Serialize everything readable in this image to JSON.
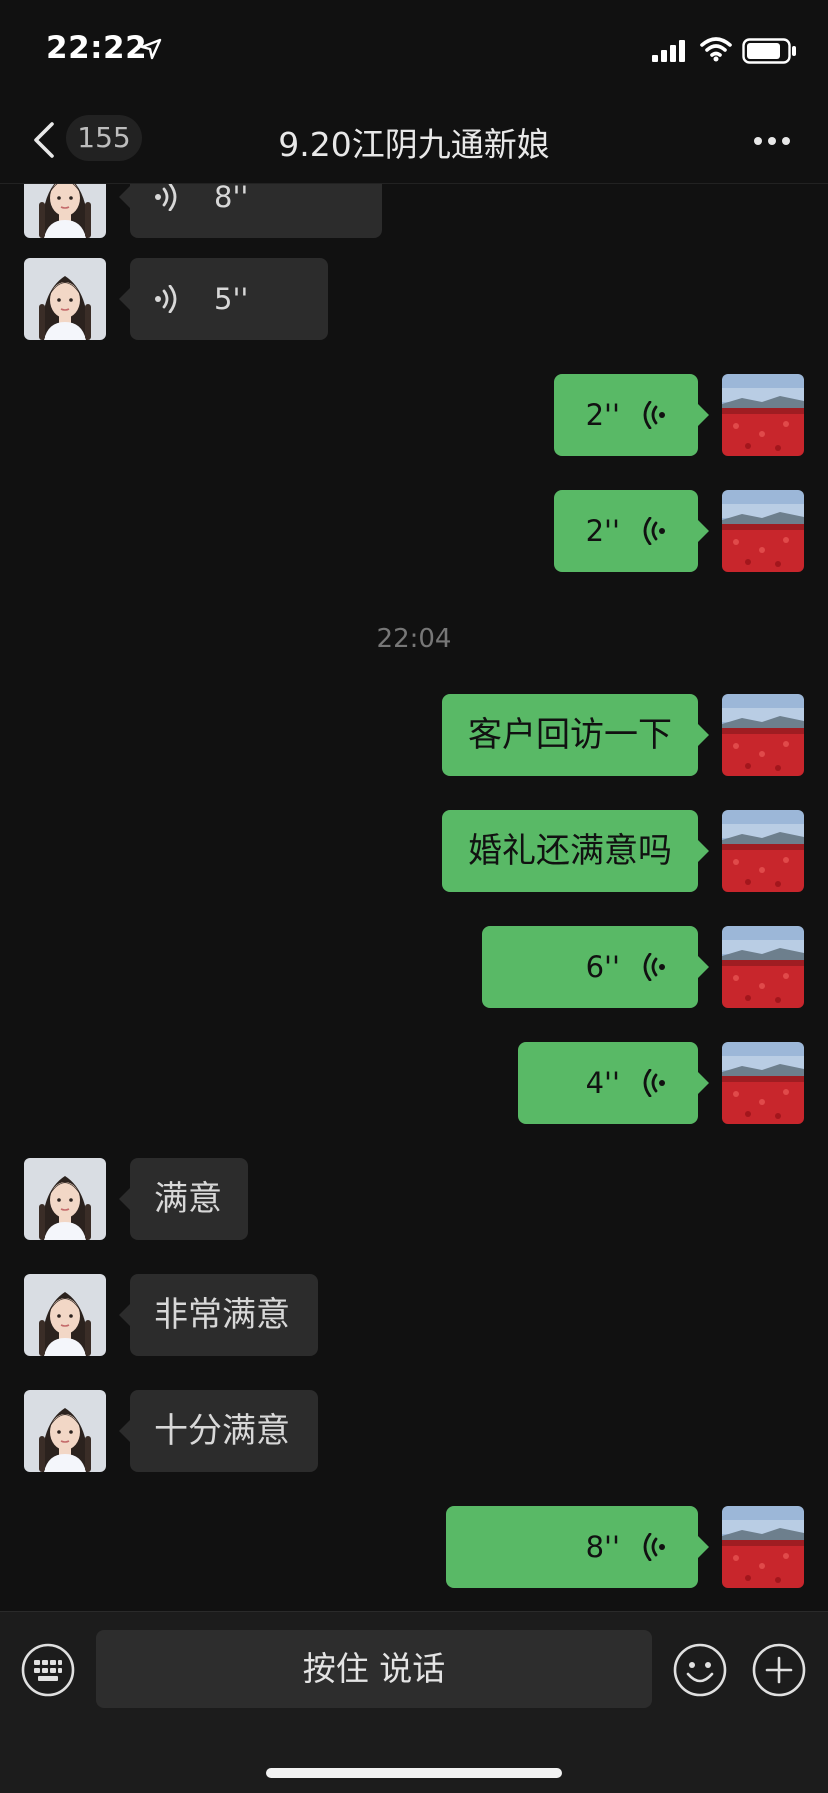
{
  "status_bar": {
    "time": "22:22"
  },
  "header": {
    "unread_count": "155",
    "title": "9.20江阴九通新娘"
  },
  "messages": [
    {
      "side": "in",
      "kind": "voice",
      "text": "8''"
    },
    {
      "side": "in",
      "kind": "voice",
      "text": "5''"
    },
    {
      "side": "out",
      "kind": "voice",
      "text": "2''"
    },
    {
      "side": "out",
      "kind": "voice",
      "text": "2''"
    },
    {
      "side": "out",
      "kind": "text",
      "text": "客户回访一下"
    },
    {
      "side": "out",
      "kind": "text",
      "text": "婚礼还满意吗"
    },
    {
      "side": "out",
      "kind": "voice",
      "text": "6''"
    },
    {
      "side": "out",
      "kind": "voice",
      "text": "4''"
    },
    {
      "side": "in",
      "kind": "text",
      "text": "满意"
    },
    {
      "side": "in",
      "kind": "text",
      "text": "非常满意"
    },
    {
      "side": "in",
      "kind": "text",
      "text": "十分满意"
    },
    {
      "side": "out",
      "kind": "voice",
      "text": "8''"
    }
  ],
  "time_divider": "22:04",
  "input_bar": {
    "hold_to_talk": "按住 说话"
  },
  "colors": {
    "background": "#111111",
    "bubble_out": "#59b966",
    "bubble_in": "#2c2c2c"
  }
}
